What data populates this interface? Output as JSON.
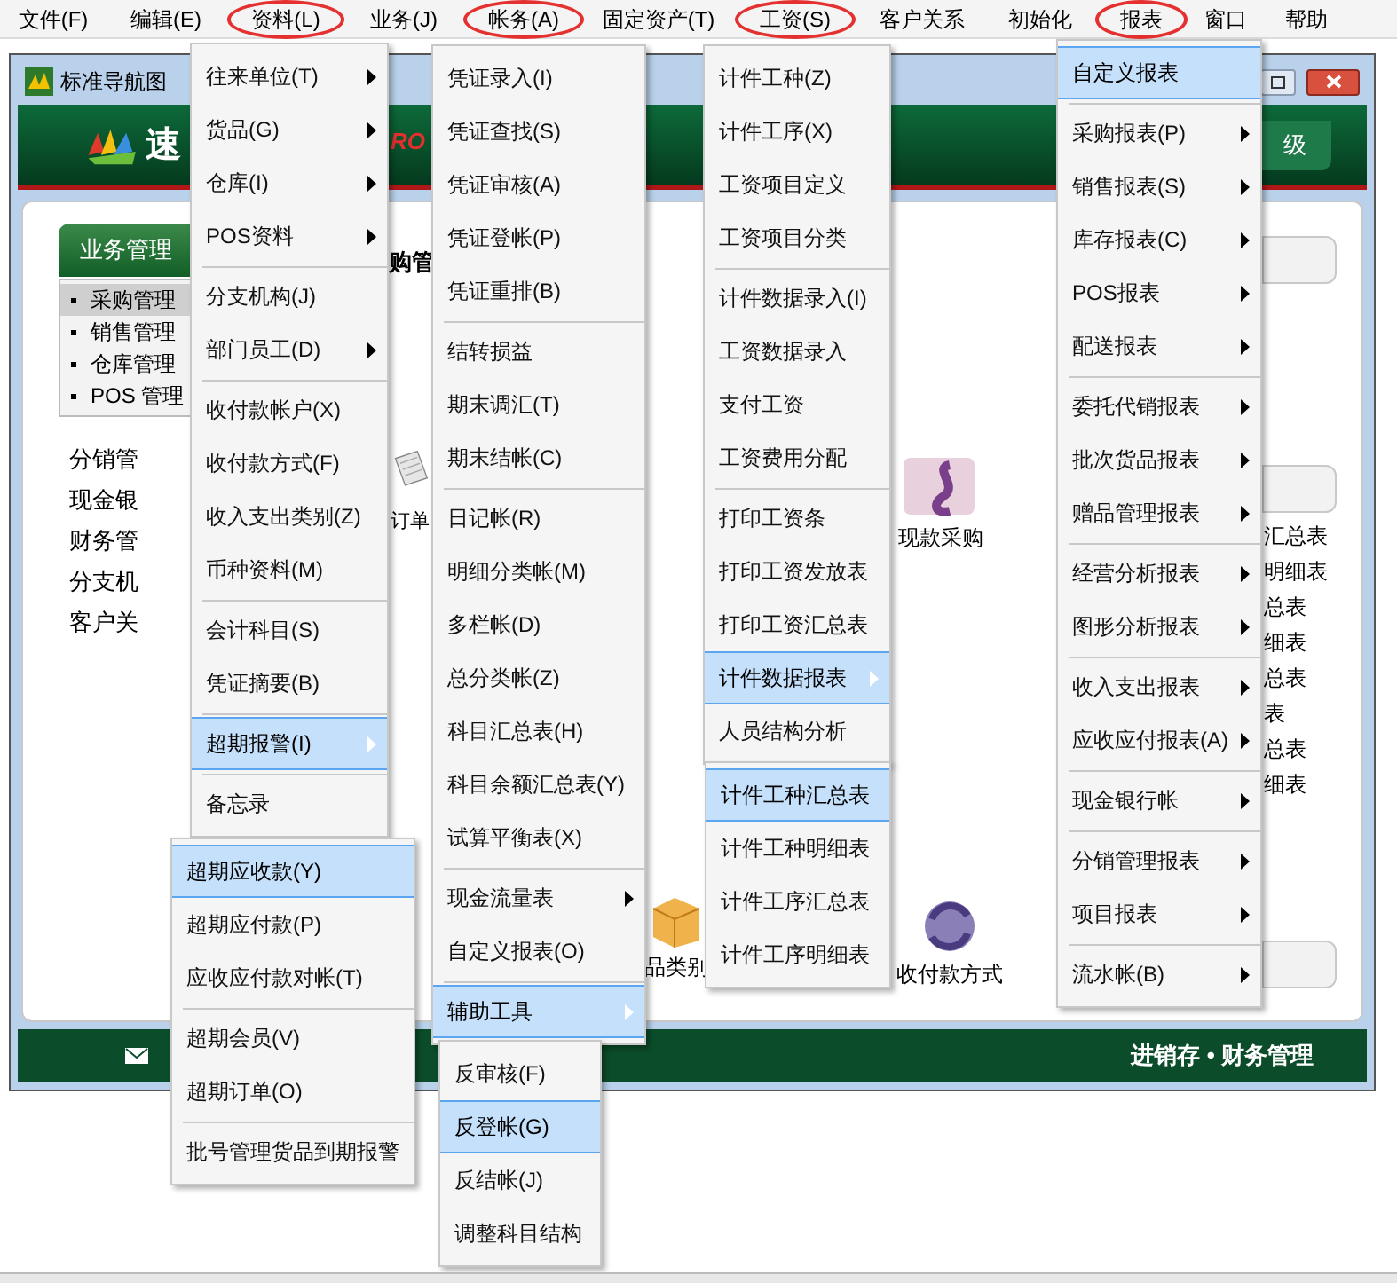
{
  "menu_bar": [
    {
      "label": "文件(F)",
      "circled": false
    },
    {
      "label": "编辑(E)",
      "circled": false
    },
    {
      "label": "资料(L)",
      "circled": true
    },
    {
      "label": "业务(J)",
      "circled": false
    },
    {
      "label": "帐务(A)",
      "circled": true
    },
    {
      "label": "固定资产(T)",
      "circled": false
    },
    {
      "label": "工资(S)",
      "circled": true
    },
    {
      "label": "客户关系",
      "circled": false
    },
    {
      "label": "初始化",
      "circled": false
    },
    {
      "label": "报表",
      "circled": true
    },
    {
      "label": "窗口",
      "circled": false
    },
    {
      "label": "帮助",
      "circled": false
    }
  ],
  "window": {
    "title": "标准导航图",
    "logo_text": "速",
    "logo_tag": "RO",
    "header_button": "级",
    "sidebar_button": "业务管理",
    "sidebar_items": [
      {
        "label": "采购管理",
        "selected": true
      },
      {
        "label": "销售管理",
        "selected": false
      },
      {
        "label": "仓库管理",
        "selected": false
      },
      {
        "label": "POS 管理",
        "selected": false
      }
    ],
    "nav_links": [
      "分销管",
      "现金银",
      "财务管",
      "分支机",
      "客户关"
    ],
    "content_heading": "购管",
    "icons": [
      {
        "label": "订单"
      },
      {
        "label": "现款采购"
      },
      {
        "label": "品类别"
      },
      {
        "label": "收付款方式"
      }
    ],
    "report_links": [
      "汇总表",
      "明细表",
      "总表",
      "细表",
      "总表",
      "表",
      "总表",
      "细表"
    ],
    "footer": "进销存 • 财务管理"
  },
  "menus": [
    {
      "items": [
        {
          "kind": "item",
          "label": "往来单位(T)",
          "submenu": true,
          "selected": false
        },
        {
          "kind": "item",
          "label": "货品(G)",
          "submenu": true,
          "selected": false
        },
        {
          "kind": "item",
          "label": "仓库(I)",
          "submenu": true,
          "selected": false
        },
        {
          "kind": "item",
          "label": "POS资料",
          "submenu": true,
          "selected": false
        },
        {
          "kind": "separator"
        },
        {
          "kind": "item",
          "label": "分支机构(J)",
          "submenu": false,
          "selected": false
        },
        {
          "kind": "item",
          "label": "部门员工(D)",
          "submenu": true,
          "selected": false
        },
        {
          "kind": "separator"
        },
        {
          "kind": "item",
          "label": "收付款帐户(X)",
          "submenu": false,
          "selected": false
        },
        {
          "kind": "item",
          "label": "收付款方式(F)",
          "submenu": false,
          "selected": false
        },
        {
          "kind": "item",
          "label": "收入支出类别(Z)",
          "submenu": false,
          "selected": false
        },
        {
          "kind": "item",
          "label": "币种资料(M)",
          "submenu": false,
          "selected": false
        },
        {
          "kind": "separator"
        },
        {
          "kind": "item",
          "label": "会计科目(S)",
          "submenu": false,
          "selected": false
        },
        {
          "kind": "item",
          "label": "凭证摘要(B)",
          "submenu": false,
          "selected": false
        },
        {
          "kind": "separator"
        },
        {
          "kind": "item",
          "label": "超期报警(I)",
          "submenu": true,
          "selected": true
        },
        {
          "kind": "separator"
        },
        {
          "kind": "item",
          "label": "备忘录",
          "submenu": false,
          "selected": false
        }
      ]
    },
    {
      "items": [
        {
          "kind": "item",
          "label": "超期应收款(Y)",
          "submenu": false,
          "selected": true
        },
        {
          "kind": "item",
          "label": "超期应付款(P)",
          "submenu": false,
          "selected": false
        },
        {
          "kind": "item",
          "label": "应收应付款对帐(T)",
          "submenu": false,
          "selected": false
        },
        {
          "kind": "separator"
        },
        {
          "kind": "item",
          "label": "超期会员(V)",
          "submenu": false,
          "selected": false
        },
        {
          "kind": "item",
          "label": "超期订单(O)",
          "submenu": false,
          "selected": false
        },
        {
          "kind": "separator"
        },
        {
          "kind": "item",
          "label": "批号管理货品到期报警",
          "submenu": false,
          "selected": false
        }
      ]
    },
    {
      "items": [
        {
          "kind": "item",
          "label": "凭证录入(I)",
          "submenu": false,
          "selected": false
        },
        {
          "kind": "item",
          "label": "凭证查找(S)",
          "submenu": false,
          "selected": false
        },
        {
          "kind": "item",
          "label": "凭证审核(A)",
          "submenu": false,
          "selected": false
        },
        {
          "kind": "item",
          "label": "凭证登帐(P)",
          "submenu": false,
          "selected": false
        },
        {
          "kind": "item",
          "label": "凭证重排(B)",
          "submenu": false,
          "selected": false
        },
        {
          "kind": "separator"
        },
        {
          "kind": "item",
          "label": "结转损益",
          "submenu": false,
          "selected": false
        },
        {
          "kind": "item",
          "label": "期末调汇(T)",
          "submenu": false,
          "selected": false
        },
        {
          "kind": "item",
          "label": "期末结帐(C)",
          "submenu": false,
          "selected": false
        },
        {
          "kind": "separator"
        },
        {
          "kind": "item",
          "label": "日记帐(R)",
          "submenu": false,
          "selected": false
        },
        {
          "kind": "item",
          "label": "明细分类帐(M)",
          "submenu": false,
          "selected": false
        },
        {
          "kind": "item",
          "label": "多栏帐(D)",
          "submenu": false,
          "selected": false
        },
        {
          "kind": "item",
          "label": "总分类帐(Z)",
          "submenu": false,
          "selected": false
        },
        {
          "kind": "item",
          "label": "科目汇总表(H)",
          "submenu": false,
          "selected": false
        },
        {
          "kind": "item",
          "label": "科目余额汇总表(Y)",
          "submenu": false,
          "selected": false
        },
        {
          "kind": "item",
          "label": "试算平衡表(X)",
          "submenu": false,
          "selected": false
        },
        {
          "kind": "separator"
        },
        {
          "kind": "item",
          "label": "现金流量表",
          "submenu": true,
          "selected": false
        },
        {
          "kind": "item",
          "label": "自定义报表(O)",
          "submenu": false,
          "selected": false
        },
        {
          "kind": "separator"
        },
        {
          "kind": "item",
          "label": "辅助工具",
          "submenu": true,
          "selected": true
        }
      ]
    },
    {
      "items": [
        {
          "kind": "item",
          "label": "反审核(F)",
          "submenu": false,
          "selected": false
        },
        {
          "kind": "item",
          "label": "反登帐(G)",
          "submenu": false,
          "selected": true
        },
        {
          "kind": "item",
          "label": "反结帐(J)",
          "submenu": false,
          "selected": false
        },
        {
          "kind": "item",
          "label": "调整科目结构",
          "submenu": false,
          "selected": false
        }
      ]
    },
    {
      "items": [
        {
          "kind": "item",
          "label": "计件工种(Z)",
          "submenu": false,
          "selected": false
        },
        {
          "kind": "item",
          "label": "计件工序(X)",
          "submenu": false,
          "selected": false
        },
        {
          "kind": "item",
          "label": "工资项目定义",
          "submenu": false,
          "selected": false
        },
        {
          "kind": "item",
          "label": "工资项目分类",
          "submenu": false,
          "selected": false
        },
        {
          "kind": "separator"
        },
        {
          "kind": "item",
          "label": "计件数据录入(I)",
          "submenu": false,
          "selected": false
        },
        {
          "kind": "item",
          "label": "工资数据录入",
          "submenu": false,
          "selected": false
        },
        {
          "kind": "item",
          "label": "支付工资",
          "submenu": false,
          "selected": false
        },
        {
          "kind": "item",
          "label": "工资费用分配",
          "submenu": false,
          "selected": false
        },
        {
          "kind": "separator"
        },
        {
          "kind": "item",
          "label": "打印工资条",
          "submenu": false,
          "selected": false
        },
        {
          "kind": "item",
          "label": "打印工资发放表",
          "submenu": false,
          "selected": false
        },
        {
          "kind": "item",
          "label": "打印工资汇总表",
          "submenu": false,
          "selected": false
        },
        {
          "kind": "item",
          "label": "计件数据报表",
          "submenu": true,
          "selected": true
        },
        {
          "kind": "item",
          "label": "人员结构分析",
          "submenu": false,
          "selected": false
        }
      ]
    },
    {
      "items": [
        {
          "kind": "item",
          "label": "计件工种汇总表",
          "submenu": false,
          "selected": true
        },
        {
          "kind": "item",
          "label": "计件工种明细表",
          "submenu": false,
          "selected": false
        },
        {
          "kind": "item",
          "label": "计件工序汇总表",
          "submenu": false,
          "selected": false
        },
        {
          "kind": "item",
          "label": "计件工序明细表",
          "submenu": false,
          "selected": false
        }
      ]
    },
    {
      "items": [
        {
          "kind": "item",
          "label": "自定义报表",
          "submenu": false,
          "selected": true
        },
        {
          "kind": "separator"
        },
        {
          "kind": "item",
          "label": "采购报表(P)",
          "submenu": true,
          "selected": false
        },
        {
          "kind": "item",
          "label": "销售报表(S)",
          "submenu": true,
          "selected": false
        },
        {
          "kind": "item",
          "label": "库存报表(C)",
          "submenu": true,
          "selected": false
        },
        {
          "kind": "item",
          "label": "POS报表",
          "submenu": true,
          "selected": false
        },
        {
          "kind": "item",
          "label": "配送报表",
          "submenu": true,
          "selected": false
        },
        {
          "kind": "separator"
        },
        {
          "kind": "item",
          "label": "委托代销报表",
          "submenu": true,
          "selected": false
        },
        {
          "kind": "item",
          "label": "批次货品报表",
          "submenu": true,
          "selected": false
        },
        {
          "kind": "item",
          "label": "赠品管理报表",
          "submenu": true,
          "selected": false
        },
        {
          "kind": "separator"
        },
        {
          "kind": "item",
          "label": "经营分析报表",
          "submenu": true,
          "selected": false
        },
        {
          "kind": "item",
          "label": "图形分析报表",
          "submenu": true,
          "selected": false
        },
        {
          "kind": "separator"
        },
        {
          "kind": "item",
          "label": "收入支出报表",
          "submenu": true,
          "selected": false
        },
        {
          "kind": "item",
          "label": "应收应付报表(A)",
          "submenu": true,
          "selected": false
        },
        {
          "kind": "separator"
        },
        {
          "kind": "item",
          "label": "现金银行帐",
          "submenu": true,
          "selected": false
        },
        {
          "kind": "separator"
        },
        {
          "kind": "item",
          "label": "分销管理报表",
          "submenu": true,
          "selected": false
        },
        {
          "kind": "item",
          "label": "项目报表",
          "submenu": true,
          "selected": false
        },
        {
          "kind": "separator"
        },
        {
          "kind": "item",
          "label": "流水帐(B)",
          "submenu": true,
          "selected": false
        }
      ]
    }
  ]
}
